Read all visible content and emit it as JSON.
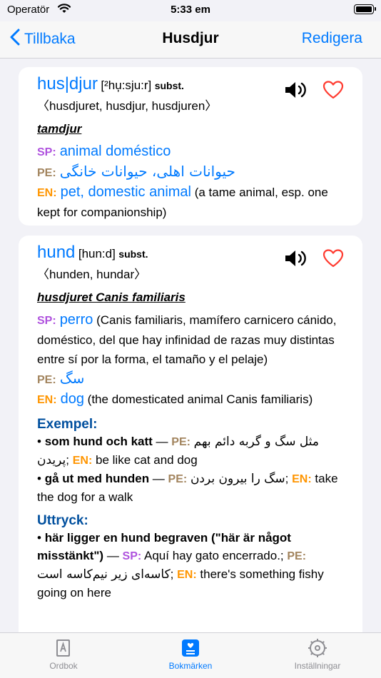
{
  "status": {
    "carrier": "Operatör",
    "time": "5:33 em"
  },
  "nav": {
    "back_label": "Tillbaka",
    "title": "Husdjur",
    "edit_label": "Redigera"
  },
  "entries": [
    {
      "headword": "hus|djur",
      "pron": "[²hu̦:sju:r]",
      "pos": "subst.",
      "forms": "〈husdjuret, husdjur, husdjuren〉",
      "synonym": "tamdjur",
      "sp_label": "SP:",
      "sp": "animal doméstico",
      "pe_label": "PE:",
      "pe": "حیوانات اهلی، حیوانات خانگی",
      "en_label": "EN:",
      "en": "pet, domestic animal",
      "en_desc": " (a tame animal, esp. one kept for companionship)"
    },
    {
      "headword": "hund",
      "pron": "[hun:d]",
      "pos": "subst.",
      "forms": "〈hunden, hundar〉",
      "synonym": "husdjuret Canis familiaris",
      "sp_label": "SP:",
      "sp": "perro",
      "sp_desc": " (Canis familiaris, mamífero carnicero cánido, doméstico, del que hay infinidad de razas muy distintas entre sí por la forma, el tamaño y el pelaje)",
      "pe_label": "PE:",
      "pe": "سگ",
      "en_label": "EN:",
      "en": "dog",
      "en_desc": " (the domesticated animal Canis familiaris)",
      "examples_title": "Exempel:",
      "examples": [
        {
          "sv": "som hund och katt",
          "dash": " — ",
          "pe_label": "PE:",
          "pe": "مثل سگ و گربه دائم بهم پریدن",
          "sep": "; ",
          "en_label": "EN:",
          "en": " be like cat and dog"
        },
        {
          "sv": "gå ut med hunden",
          "dash": " — ",
          "pe_label": "PE:",
          "pe": "سگ را بیرون بردن",
          "sep": "; ",
          "en_label": "EN:",
          "en": " take the dog for a walk"
        }
      ],
      "idioms_title": "Uttryck:",
      "idioms": [
        {
          "sv": "här ligger en hund begraven (\"här är något misstänkt\")",
          "dash": " — ",
          "sp_label": "SP:",
          "sp": " Aquí hay gato encerrado.",
          "sep": "; ",
          "pe_label": "PE:",
          "pe": "کاسه‌ای زیر نیم‌کاسه است",
          "sep2": "; ",
          "en_label": "EN:",
          "en": " there's something fishy going on here"
        }
      ]
    }
  ],
  "tabs": [
    {
      "label": "Ordbok",
      "icon": "dictionary-icon"
    },
    {
      "label": "Bokmärken",
      "icon": "bookmarks-icon"
    },
    {
      "label": "Inställningar",
      "icon": "gear-icon"
    }
  ],
  "colors": {
    "accent": "#007aff",
    "sp": "#af52de",
    "pe": "#a2845e",
    "en": "#ff9500",
    "heart": "#ff3b30"
  }
}
